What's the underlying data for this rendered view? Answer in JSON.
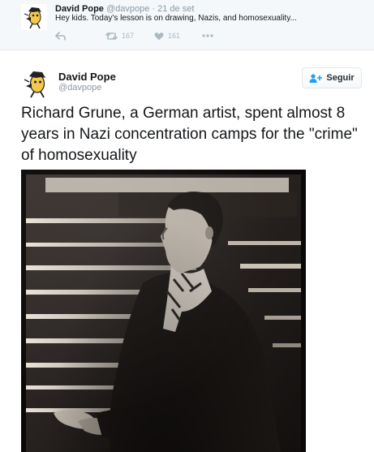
{
  "parent_tweet": {
    "author_name": "David Pope",
    "author_handle": "@davpope",
    "separator": "·",
    "date": "21 de set",
    "text": "Hey kids. Today's lesson is on drawing, Nazis, and homosexuality...",
    "retweet_count": "167",
    "like_count": "161",
    "icons": [
      "reply-icon",
      "retweet-icon",
      "like-icon",
      "more-icon"
    ]
  },
  "main_tweet": {
    "author_name": "David Pope",
    "author_handle": "@davpope",
    "follow_label": "Seguir",
    "text": "Richard Grune, a German artist, spent almost 8 years in Nazi concentration camps for the \"crime\" of homosexuality"
  },
  "colors": {
    "meta_grey": "#8899a6",
    "action_grey": "#aab8c2",
    "follow_icon_blue": "#1da1f2",
    "parent_background": "#f5f8fa"
  }
}
